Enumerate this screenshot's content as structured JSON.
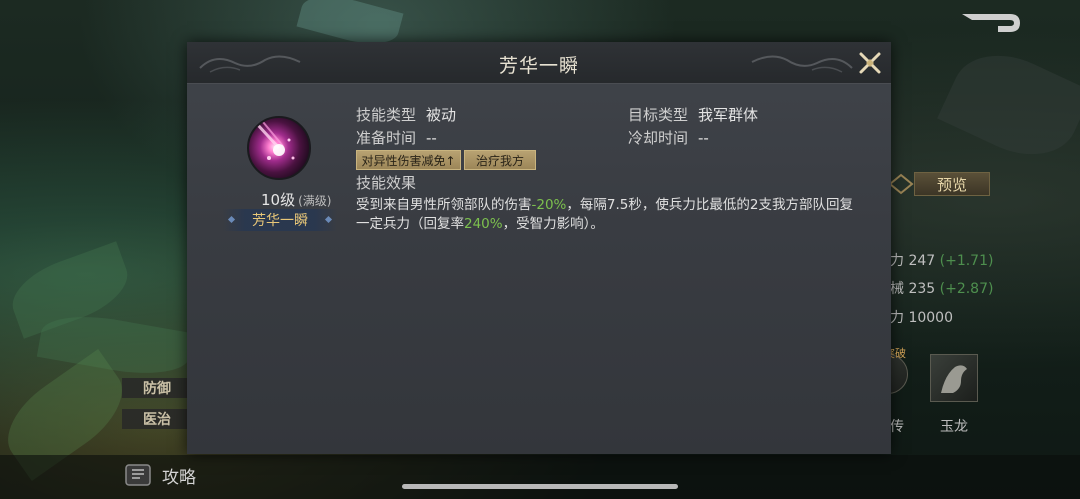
{
  "dialog": {
    "title": "芳华一瞬",
    "skill": {
      "level": "10级",
      "level_max": "(满级)",
      "name": "芳华一瞬",
      "icon": "meteor-skill-icon"
    },
    "fields": {
      "type_label": "技能类型",
      "type_value": "被动",
      "target_label": "目标类型",
      "target_value": "我军群体",
      "prep_label": "准备时间",
      "prep_value": "--",
      "cooldown_label": "冷却时间",
      "cooldown_value": "--"
    },
    "tags": [
      "对异性伤害减免↑",
      "治疗我方"
    ],
    "effect_title": "技能效果",
    "effect": {
      "p1": "受到来自男性所领部队的伤害",
      "v1": "-20%",
      "p2": "，每隔7.5秒，使兵力比最低的2支我方部队回复一定兵力（回复率",
      "v2": "240%",
      "p3": "，受智力影响）。"
    }
  },
  "background": {
    "preview_button": "预览",
    "stats": [
      {
        "label": "力 247",
        "bonus": "(+1.71)"
      },
      {
        "label": "械 235",
        "bonus": "(+2.87)"
      },
      {
        "label": "力 10000",
        "bonus": ""
      }
    ],
    "left_tags": [
      "防御",
      "医治"
    ],
    "skill_slots": [
      "传",
      "玉龙"
    ],
    "slot_badge": "突破",
    "guide_label": "攻略"
  },
  "colors": {
    "highlight_green": "#7cc04e",
    "skill_name_gold": "#e8c778",
    "tag_gold": "#b8a272"
  }
}
